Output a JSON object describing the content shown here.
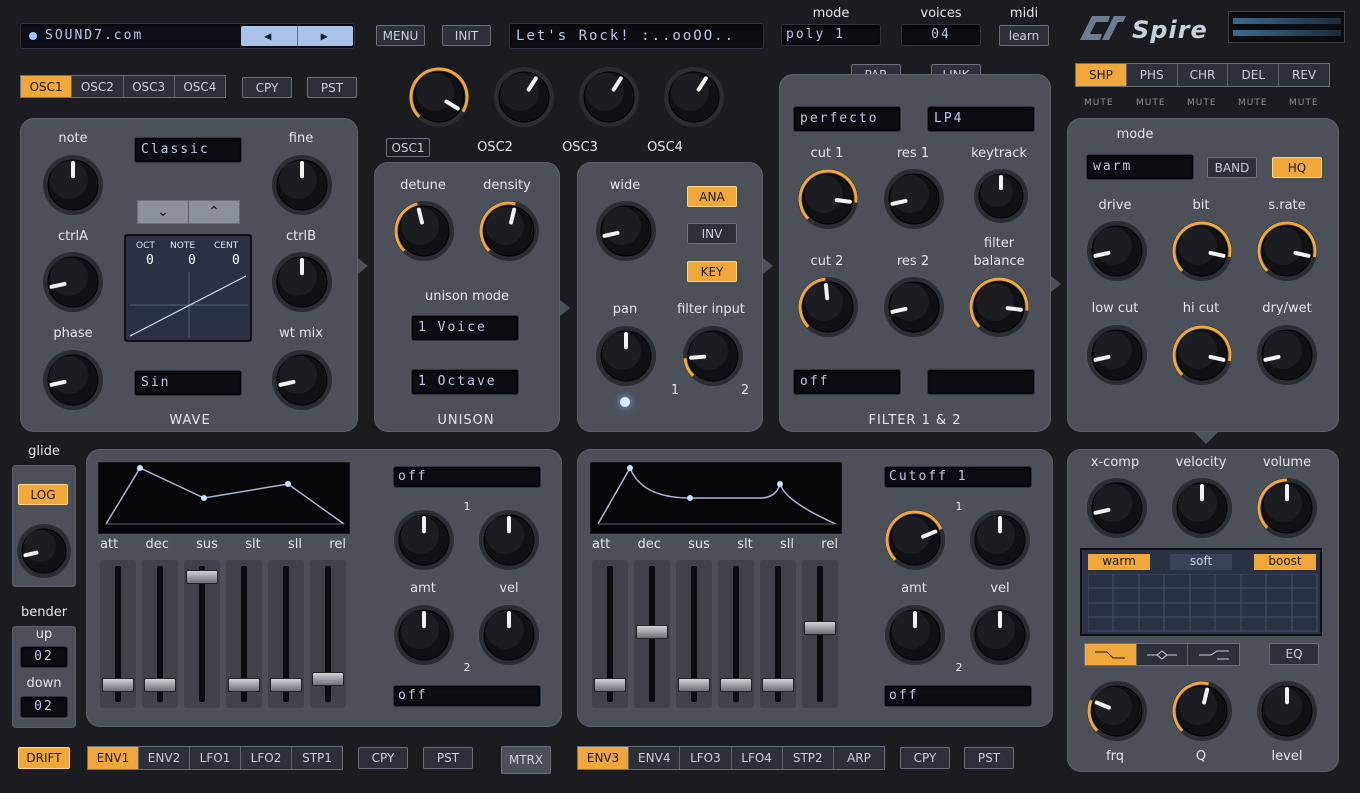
{
  "preset": {
    "bank": "SOUND7.com",
    "name": "Let's Rock! :..ooOO..",
    "prev": "◀",
    "next": "▶"
  },
  "top": {
    "menu": "MENU",
    "init": "INIT",
    "mode_label": "mode",
    "mode_value": "poly 1",
    "voices_label": "voices",
    "voices_value": "04",
    "midi_label": "midi",
    "midi_learn": "learn",
    "logo": "Spire"
  },
  "osc_tabs": [
    "OSC1",
    "OSC2",
    "OSC3",
    "OSC4"
  ],
  "copy": "CPY",
  "paste": "PST",
  "osc_levels": [
    "OSC1",
    "OSC2",
    "OSC3",
    "OSC4"
  ],
  "osc": {
    "note": "note",
    "fine": "fine",
    "ctrlA": "ctrlA",
    "ctrlB": "ctrlB",
    "phase": "phase",
    "wtmix": "wt mix",
    "mode": "Classic",
    "wave_select": "Sin",
    "section": "WAVE",
    "oct_label": "OCT",
    "note_label": "NOTE",
    "cent_label": "CENT",
    "oct": "0",
    "note_val": "0",
    "cent": "0",
    "down": "⌄",
    "up": "⌃"
  },
  "unison": {
    "detune": "detune",
    "density": "density",
    "mode_label": "unison mode",
    "voices": "1 Voice",
    "octave": "1 Octave",
    "section": "UNISON"
  },
  "wide": {
    "wide": "wide",
    "pan": "pan",
    "filter_input": "filter input",
    "ana": "ANA",
    "inv": "INV",
    "key": "KEY",
    "in1": "1",
    "in2": "2"
  },
  "filter": {
    "par": "PAR",
    "link": "LINK",
    "type1": "perfecto",
    "type2": "LP4",
    "cut1": "cut 1",
    "res1": "res 1",
    "keytrack": "keytrack",
    "cut2": "cut 2",
    "res2": "res 2",
    "balance1": "filter",
    "balance2": "balance",
    "mod1": "off",
    "mod2": "",
    "section": "FILTER 1 & 2"
  },
  "fx_tabs": [
    "SHP",
    "PHS",
    "CHR",
    "DEL",
    "REV"
  ],
  "mute": "MUTE",
  "shaper": {
    "mode_label": "mode",
    "mode_value": "warm",
    "band": "BAND",
    "hq": "HQ",
    "drive": "drive",
    "bit": "bit",
    "srate": "s.rate",
    "lowcut": "low cut",
    "hicut": "hi cut",
    "drywet": "dry/wet"
  },
  "glide": {
    "label": "glide",
    "log": "LOG"
  },
  "bender": {
    "label": "bender",
    "up": "up",
    "up_val": "02",
    "down": "down",
    "down_val": "02"
  },
  "env": {
    "labels": [
      "att",
      "dec",
      "sus",
      "slt",
      "sll",
      "rel"
    ]
  },
  "envA": {
    "src": "off",
    "dst": "off",
    "n1": "1",
    "n2": "2",
    "amt": "amt",
    "vel": "vel",
    "faders": [
      0.08,
      0.08,
      0.97,
      0.08,
      0.08,
      0.13
    ]
  },
  "envB": {
    "src": "Cutoff 1",
    "dst": "off",
    "n1": "1",
    "n2": "2",
    "amt": "amt",
    "vel": "vel",
    "faders": [
      0.08,
      0.52,
      0.08,
      0.08,
      0.08,
      0.55
    ]
  },
  "mod_tabs_left": [
    "ENV1",
    "ENV2",
    "LFO1",
    "LFO2",
    "STP1"
  ],
  "mod_tabs_right": [
    "ENV3",
    "ENV4",
    "LFO3",
    "LFO4",
    "STP2",
    "ARP"
  ],
  "drift": "DRIFT",
  "mtrx": "MTRX",
  "eq": {
    "xcomp": "x-comp",
    "velocity": "velocity",
    "volume": "volume",
    "warm": "warm",
    "soft": "soft",
    "boost": "boost",
    "eq": "EQ",
    "frq": "frq",
    "q": "Q",
    "level": "level"
  },
  "colors": {
    "accent": "#f0a83a",
    "panel": "#4c5058",
    "bg": "#1b1c20"
  }
}
